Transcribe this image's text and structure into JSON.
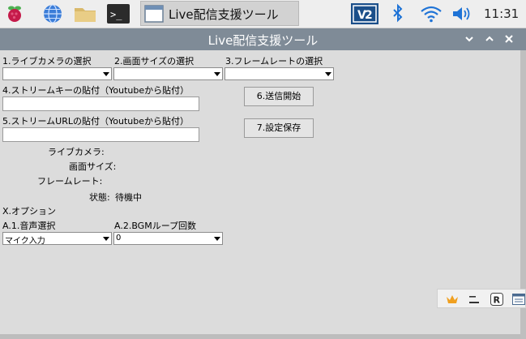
{
  "taskbar": {
    "icons": [
      "raspberry-icon",
      "globe-icon",
      "folder-icon",
      "terminal-icon",
      "window-icon"
    ],
    "terminal_glyph": ">_",
    "task_title": "Live配信支援ツール",
    "tray_icons": [
      "vnc-icon",
      "bluetooth-icon",
      "wifi-icon",
      "volume-icon"
    ],
    "clock": "11:31"
  },
  "window": {
    "title": "Live配信支援ツール",
    "controls": [
      "chevron-down-icon",
      "chevron-up-icon",
      "close-icon"
    ]
  },
  "form": {
    "camera_label": "1.ライブカメラの選択",
    "size_label": "2.画面サイズの選択",
    "fps_label": "3.フレームレートの選択",
    "camera_value": "",
    "size_value": "",
    "fps_value": "",
    "streamkey_label": "4.ストリームキーの貼付（Youtubeから貼付）",
    "streamkey_value": "",
    "streamurl_label": "5.ストリームURLの貼付（Youtubeから貼付）",
    "streamurl_value": "",
    "start_button": "6.送信開始",
    "save_button": "7.設定保存",
    "camera_status_label": "ライブカメラ:",
    "size_status_label": "画面サイズ:",
    "fps_status_label": "フレームレート:",
    "state_label": "状態:",
    "state_value": "待機中",
    "options_label": "X.オプション",
    "audio_label": "A.1.音声選択",
    "audio_value": "マイク入力",
    "bgm_label": "A.2.BGMループ回数",
    "bgm_value": "0"
  },
  "tray_panel": {
    "icons": [
      "crown-icon",
      "minimize-icon",
      "r-icon",
      "window-list-icon"
    ],
    "r_glyph": "R"
  },
  "colors": {
    "titlebar": "#7f8b97",
    "client_bg": "#dcdcdc",
    "taskbar_bg": "#eeeeee",
    "accent_blue": "#1e73d6",
    "vnc_bg": "#1b4f8a"
  }
}
